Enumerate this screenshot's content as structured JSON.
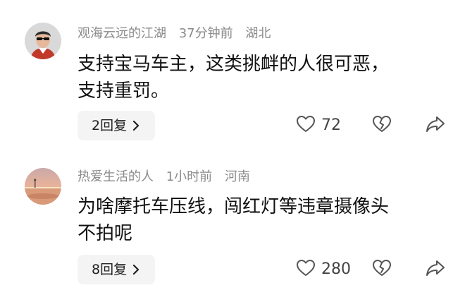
{
  "comments": [
    {
      "username": "观海云远的江湖",
      "time": "37分钟前",
      "location": "湖北",
      "text_lines": [
        "支持宝马车主，这类挑衅的人很可恶，",
        "支持重罚。"
      ],
      "replies_label": "2回复",
      "likes": "72",
      "avatar_icon": "man-with-sunglasses-avatar"
    },
    {
      "username": "热爱生活的人",
      "time": "1小时前",
      "location": "河南",
      "text_lines": [
        "为啥摩托车压线，闯红灯等违章摄像头",
        "不拍呢"
      ],
      "replies_label": "8回复",
      "likes": "280",
      "avatar_icon": "sunset-beach-avatar"
    }
  ],
  "colors": {
    "meta_text": "#8a8a8a",
    "body_text": "#111111",
    "reply_bg": "#f4f4f4",
    "icon_stroke": "#555555"
  }
}
